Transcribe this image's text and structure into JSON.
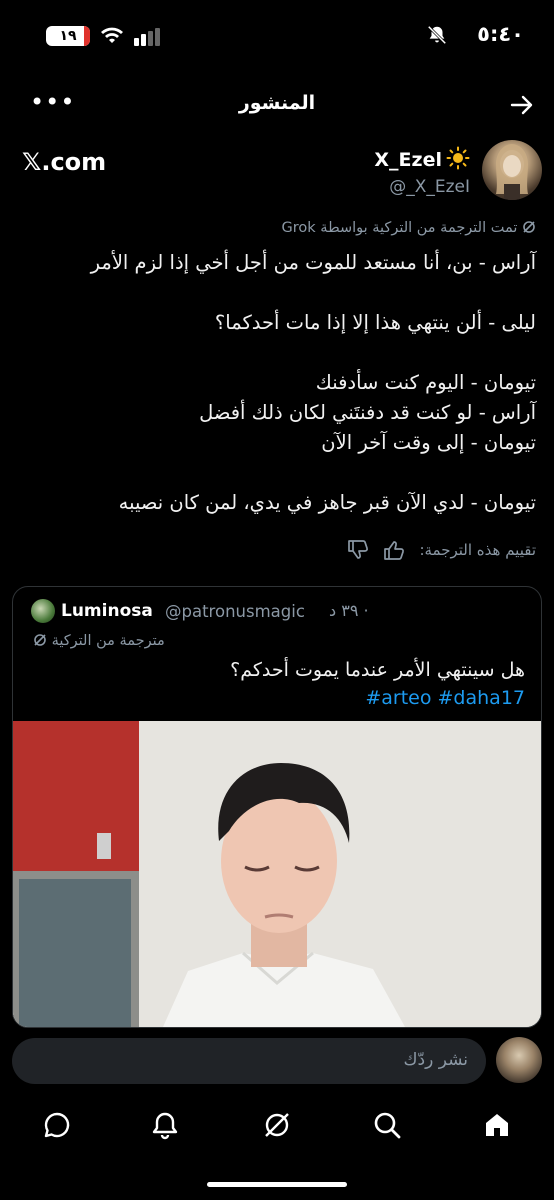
{
  "status_bar": {
    "time": "٥:٤٠",
    "battery": "١٩"
  },
  "header": {
    "title": "المنشور"
  },
  "author": {
    "name": "X_Ezel",
    "handle": "@_X_EzeI",
    "source": "𝕏.com"
  },
  "post": {
    "translated_note": "تمت الترجمة من التركية بواسطة Grok",
    "lines": [
      "آراس - بن، أنا مستعد للموت من أجل أخي إذا لزم الأمر",
      "",
      "ليلى - ألن ينتهي هذا إلا إذا مات أحدكما؟",
      "",
      "تيومان - اليوم كنت سأدفنك",
      "آراس - لو كنت قد دفنتَني لكان ذلك أفضل",
      "تيومان - إلى وقت آخر الآن",
      "",
      "تيومان - لدي الآن قبر جاهز في يدي، لمن كان نصيبه"
    ],
    "rate_label": "تقييم هذه الترجمة:"
  },
  "quote": {
    "name": "Luminosa",
    "handle": "@patronusmagic",
    "time": "· ٣٩ د",
    "translated": "مترجمة من التركية",
    "text": "هل سينتهي الأمر عندما يموت أحدكم؟",
    "tags": "#arteo #daha17"
  },
  "reply": {
    "placeholder": "نشر ردّك"
  },
  "tabs": [
    "home-icon",
    "search-icon",
    "grok-icon",
    "notifications-icon",
    "messages-icon"
  ]
}
